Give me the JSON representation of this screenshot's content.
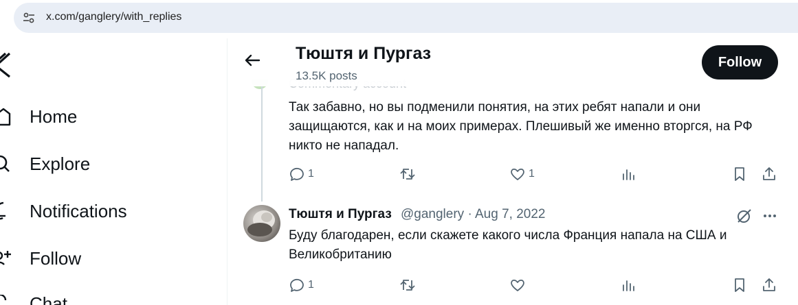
{
  "browser": {
    "url": "x.com/ganglery/with_replies"
  },
  "nav": {
    "items": [
      {
        "label": "Home",
        "icon": "home-icon"
      },
      {
        "label": "Explore",
        "icon": "search-icon"
      },
      {
        "label": "Notifications",
        "icon": "bell-icon"
      },
      {
        "label": "Follow",
        "icon": "add-user-icon"
      },
      {
        "label": "Chat",
        "icon": "chat-icon"
      }
    ]
  },
  "header": {
    "name": "Тюштя и Пургаз",
    "posts": "13.5K posts",
    "follow_label": "Follow"
  },
  "ghost": {
    "text": "Commentary account"
  },
  "tweets": [
    {
      "text": "Так забавно, но вы подменили понятия, на этих ребят напали и они защищаются, как и на моих примерах. Плешивый же именно вторгся,  на РФ никто не нападал.",
      "replies": "1",
      "likes": "1"
    },
    {
      "name": "Тюштя и Пургаз",
      "meta": "@ganglery · Aug 7, 2022",
      "text": "Буду благодарен, если скажете какого числа Франция напала на США и Великобританию",
      "replies": "1",
      "likes": ""
    }
  ],
  "colors": {
    "text": "#0f1419",
    "muted": "#536471",
    "follow_bg": "#0f1419",
    "thread_line": "#cfd9de"
  }
}
